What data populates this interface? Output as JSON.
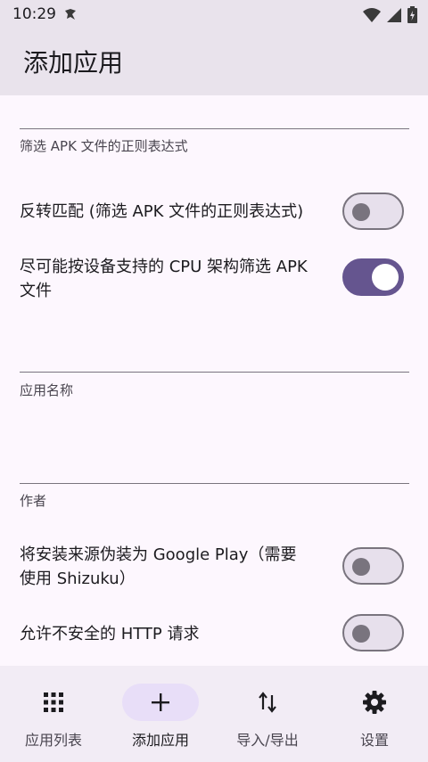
{
  "status_bar": {
    "time": "10:29"
  },
  "header": {
    "title": "添加应用"
  },
  "form": {
    "apk_filter_label": "筛选 APK 文件的正则表达式",
    "invert_filter_label": "反转匹配 (筛选 APK 文件的正则表达式)",
    "invert_filter_on": false,
    "cpu_filter_label_line1": "尽可能按设备支持的 CPU 架构筛选 APK",
    "cpu_filter_label_line2": "文件",
    "cpu_filter_on": true,
    "app_name_label": "应用名称",
    "author_label": "作者",
    "google_play_label_line1": "将安装来源伪装为 Google Play（需要",
    "google_play_label_line2": "使用 Shizuku）",
    "google_play_on": false,
    "http_label": "允许不安全的 HTTP 请求",
    "http_on": false
  },
  "nav": {
    "items": [
      {
        "label": "应用列表",
        "icon": "grid-icon"
      },
      {
        "label": "添加应用",
        "icon": "add-icon"
      },
      {
        "label": "导入/导出",
        "icon": "import-export-icon"
      },
      {
        "label": "设置",
        "icon": "gear-icon"
      }
    ],
    "active_index": 1
  },
  "colors": {
    "accent": "#65558f",
    "surface": "#fdf7fe",
    "topbar": "#e9e3ec",
    "nav": "#f2ecf5",
    "active_pill": "#e8def8"
  }
}
